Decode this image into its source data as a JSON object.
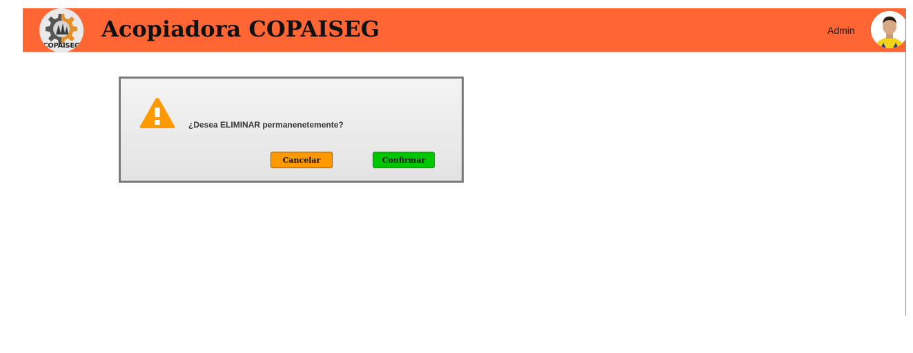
{
  "header": {
    "app_title": "Acopiadora COPAISEG",
    "logo_text": "COPAISEG",
    "user_name": "Admin"
  },
  "dialog": {
    "icon": "warning-icon",
    "message": "¿Desea ELIMINAR permanenetemente?",
    "cancel_label": "Cancelar",
    "confirm_label": "Confirmar"
  },
  "colors": {
    "header_bg": "#ff6633",
    "cancel_button": "#ff9900",
    "confirm_button": "#00c600",
    "warning_icon": "#ff9900"
  }
}
